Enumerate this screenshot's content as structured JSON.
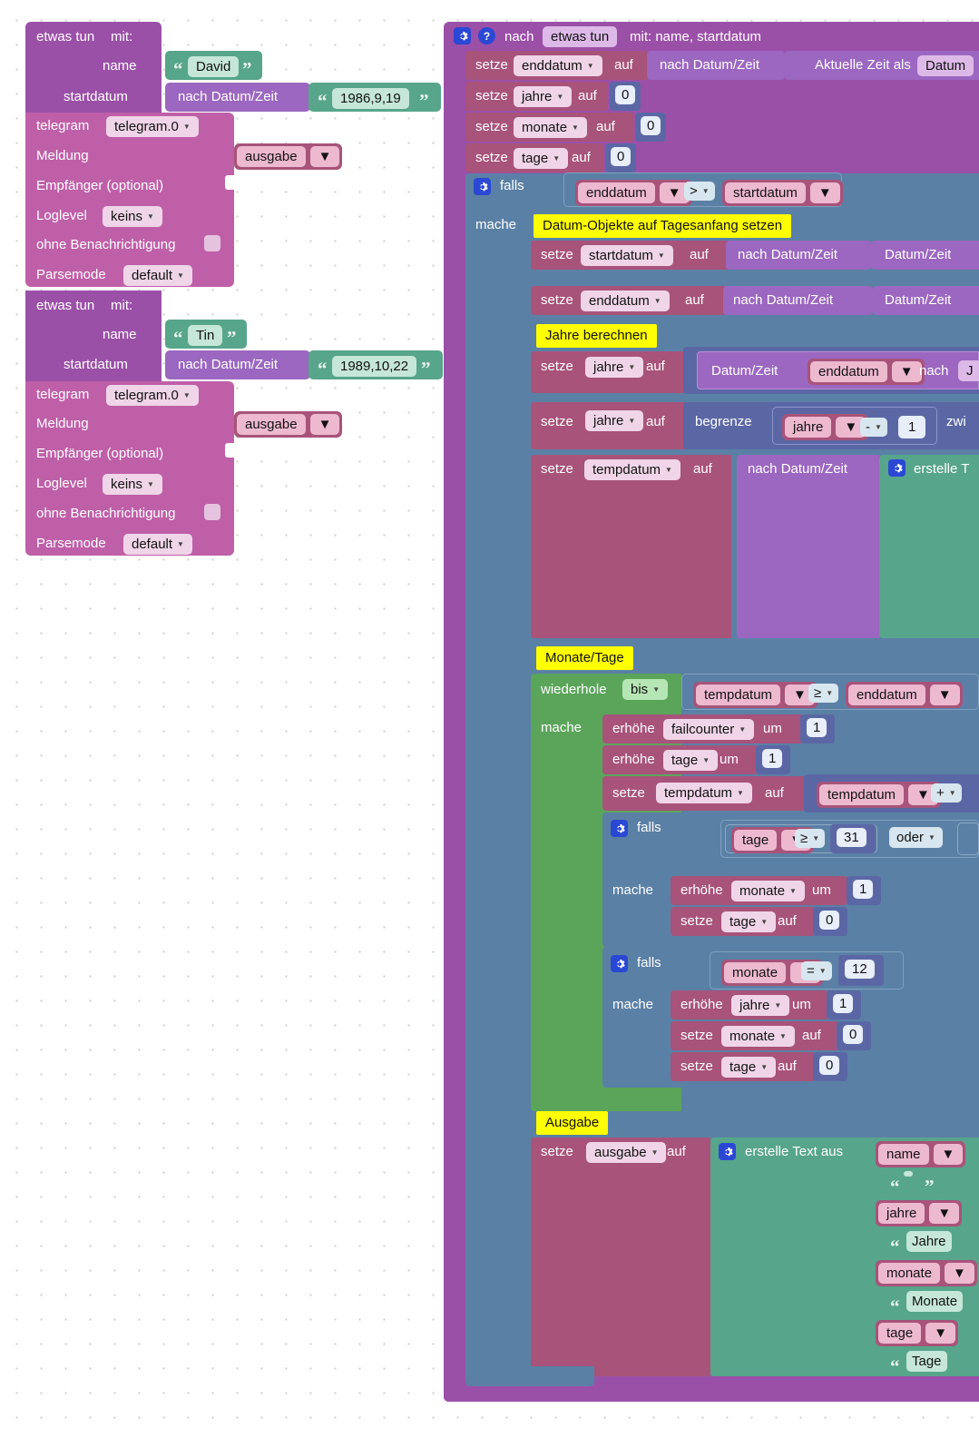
{
  "meta": {
    "app": "Blockly visual programming canvas",
    "language": "de"
  },
  "left_column": {
    "calls": [
      {
        "header_label": "etwas tun",
        "header_with": "mit:",
        "args": [
          {
            "name": "name",
            "type": "text",
            "value": "David"
          },
          {
            "name": "startdatum",
            "type": "datetime",
            "converter": "nach Datum/Zeit",
            "value": "1986,9,19"
          }
        ],
        "telegram": {
          "instance_label": "telegram",
          "instance_value": "telegram.0",
          "message_label": "Meldung",
          "message_var": "ausgabe",
          "recipient_label": "Empfänger (optional)",
          "loglevel_label": "Loglevel",
          "loglevel_value": "keins",
          "silent_label": "ohne Benachrichtigung",
          "parsemode_label": "Parsemode",
          "parsemode_value": "default"
        }
      },
      {
        "header_label": "etwas tun",
        "header_with": "mit:",
        "args": [
          {
            "name": "name",
            "type": "text",
            "value": "Tin"
          },
          {
            "name": "startdatum",
            "type": "datetime",
            "converter": "nach Datum/Zeit",
            "value": "1989,10,22"
          }
        ],
        "telegram": {
          "instance_label": "telegram",
          "instance_value": "telegram.0",
          "message_label": "Meldung",
          "message_var": "ausgabe",
          "recipient_label": "Empfänger (optional)",
          "loglevel_label": "Loglevel",
          "loglevel_value": "keins",
          "silent_label": "ohne Benachrichtigung",
          "parsemode_label": "Parsemode",
          "parsemode_value": "default"
        }
      }
    ]
  },
  "procedure": {
    "prefix": "nach",
    "name": "etwas tun",
    "params_label": "mit: name, startdatum",
    "init_statements": [
      {
        "keyword": "setze",
        "variable": "enddatum",
        "to": "auf",
        "value_kind": "datetime",
        "converter": "nach Datum/Zeit",
        "inner": "Aktuelle Zeit als",
        "inner_field": "Datum"
      },
      {
        "keyword": "setze",
        "variable": "jahre",
        "to": "auf",
        "value_kind": "number",
        "number": "0"
      },
      {
        "keyword": "setze",
        "variable": "monate",
        "to": "auf",
        "value_kind": "number",
        "number": "0"
      },
      {
        "keyword": "setze",
        "variable": "tage",
        "to": "auf",
        "value_kind": "number",
        "number": "0"
      }
    ],
    "if_block": {
      "if_label": "falls",
      "do_label": "mache",
      "condition": {
        "left": "enddatum",
        "op": ">",
        "right": "startdatum"
      },
      "sections": [
        {
          "note": "Datum-Objekte auf Tagesanfang setzen",
          "statements": [
            {
              "keyword": "setze",
              "variable": "startdatum",
              "to": "auf",
              "converter": "nach Datum/Zeit",
              "inner": "Datum/Zeit"
            },
            {
              "keyword": "setze",
              "variable": "enddatum",
              "to": "auf",
              "converter": "nach Datum/Zeit",
              "inner": "Datum/Zeit"
            }
          ]
        },
        {
          "note": "Jahre berechnen",
          "statements": [
            {
              "keyword": "setze",
              "variable": "jahre",
              "to": "auf",
              "expr_label": "Datum/Zeit",
              "expr_var": "enddatum",
              "expr_tail": "nach",
              "expr_tail2": "J"
            },
            {
              "keyword": "setze",
              "variable": "jahre",
              "to": "auf",
              "clamp_label": "begrenze",
              "clamp_var": "jahre",
              "clamp_op": "-",
              "clamp_num": "1",
              "clamp_tail": "zwi"
            },
            {
              "keyword": "setze",
              "variable": "tempdatum",
              "to": "auf",
              "converter": "nach Datum/Zeit",
              "text_create": "erstelle T"
            }
          ]
        },
        {
          "note": "Monate/Tage",
          "loop": {
            "repeat_label": "wiederhole",
            "mode": "bis",
            "do_label": "mache",
            "condition": {
              "left": "tempdatum",
              "op": "≥",
              "right": "enddatum"
            },
            "body": [
              {
                "keyword": "erhöhe",
                "variable": "failcounter",
                "to": "um",
                "number": "1"
              },
              {
                "keyword": "erhöhe",
                "variable": "tage",
                "to": "um",
                "number": "1"
              },
              {
                "keyword": "setze",
                "variable": "tempdatum",
                "to": "auf",
                "expr_var": "tempdatum",
                "expr_op": "+"
              }
            ],
            "inner_ifs": [
              {
                "if_label": "falls",
                "do_label": "mache",
                "condition": {
                  "left": "tage",
                  "op": "≥",
                  "num": "31",
                  "joiner": "oder"
                },
                "body": [
                  {
                    "keyword": "erhöhe",
                    "variable": "monate",
                    "to": "um",
                    "number": "1"
                  },
                  {
                    "keyword": "setze",
                    "variable": "tage",
                    "to": "auf",
                    "number": "0"
                  }
                ]
              },
              {
                "if_label": "falls",
                "do_label": "mache",
                "condition": {
                  "left": "monate",
                  "op": "=",
                  "num": "12"
                },
                "body": [
                  {
                    "keyword": "erhöhe",
                    "variable": "jahre",
                    "to": "um",
                    "number": "1"
                  },
                  {
                    "keyword": "setze",
                    "variable": "monate",
                    "to": "auf",
                    "number": "0"
                  },
                  {
                    "keyword": "setze",
                    "variable": "tage",
                    "to": "auf",
                    "number": "0"
                  }
                ]
              }
            ]
          }
        },
        {
          "note": "Ausgabe",
          "output": {
            "keyword": "setze",
            "variable": "ausgabe",
            "to": "auf",
            "create_text_label": "erstelle Text aus",
            "items": [
              {
                "kind": "variable",
                "value": "name"
              },
              {
                "kind": "text",
                "value": " "
              },
              {
                "kind": "variable",
                "value": "jahre"
              },
              {
                "kind": "text",
                "value": "Jahre"
              },
              {
                "kind": "variable",
                "value": "monate"
              },
              {
                "kind": "text",
                "value": "Monate"
              },
              {
                "kind": "variable",
                "value": "tage"
              },
              {
                "kind": "text",
                "value": "Tage"
              }
            ]
          }
        }
      ]
    }
  },
  "colors": {
    "procedure": "#9B50A8",
    "telegram": "#BF5FA8",
    "variables": "#A8537A",
    "logic": "#5B80A5",
    "math": "#5B67A5",
    "loops": "#5BA55B",
    "text": "#57A58B",
    "datetime": "#9B67C0",
    "comment": "#FFFF00"
  }
}
